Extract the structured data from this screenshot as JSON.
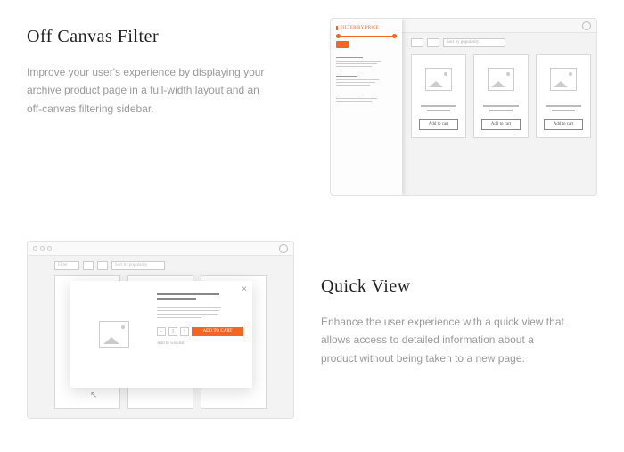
{
  "feature1": {
    "title": "Off Canvas Filter",
    "desc": "Improve your user's experience by displaying your archive product page in a full-width layout and an off-canvas filtering sidebar.",
    "mock": {
      "sidebar_title": "FILTER BY PRICE",
      "sort_label": "Sort by popularity",
      "add_to_cart": "Add to cart"
    }
  },
  "feature2": {
    "title": "Quick View",
    "desc": "Enhance the user experience with a quick view that allows access to detailed information about a product without being taken to a new page.",
    "mock": {
      "filter_label": "Filter",
      "sort_label": "Sort by popularity",
      "add_to_cart": "ADD TO CART",
      "wishlist": "Add to wishlist",
      "qty": "1"
    }
  }
}
